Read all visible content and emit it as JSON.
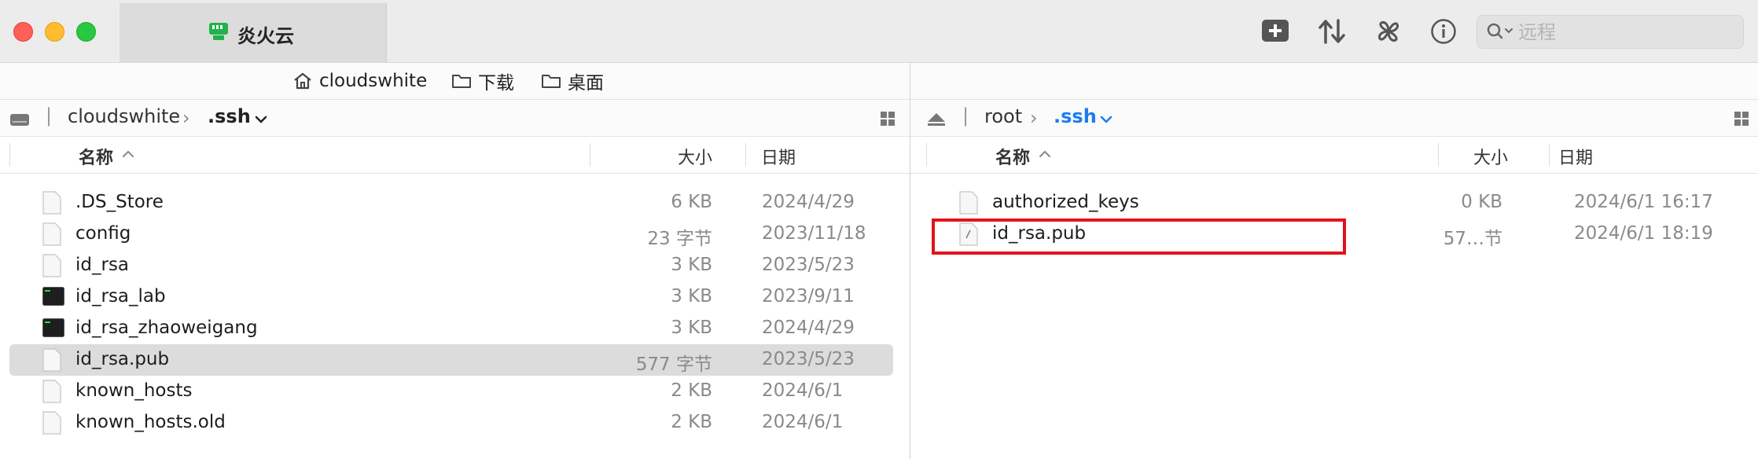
{
  "window": {
    "tab_title": "炎火云"
  },
  "toolbar": {
    "icons": [
      "new-plus-icon",
      "transfer-arrows-icon",
      "fan-icon",
      "info-icon"
    ],
    "search_placeholder": "远程"
  },
  "left": {
    "favorites": [
      {
        "icon": "home-icon",
        "label": "cloudswhite"
      },
      {
        "icon": "folder-icon",
        "label": "下载"
      },
      {
        "icon": "folder-icon",
        "label": "桌面"
      }
    ],
    "path": {
      "root": "cloudswhite",
      "current": ".ssh"
    },
    "columns": {
      "name": "名称",
      "size": "大小",
      "date": "日期"
    },
    "files": [
      {
        "name": ".DS_Store",
        "size": "6 KB",
        "date": "2024/4/29",
        "icon": "document-icon"
      },
      {
        "name": "config",
        "size": "23 字节",
        "date": "2023/11/18",
        "icon": "document-icon"
      },
      {
        "name": "id_rsa",
        "size": "3 KB",
        "date": "2023/5/23",
        "icon": "document-icon"
      },
      {
        "name": "id_rsa_lab",
        "size": "3 KB",
        "date": "2023/9/11",
        "icon": "terminal-file-icon"
      },
      {
        "name": "id_rsa_zhaoweigang",
        "size": "3 KB",
        "date": "2024/4/29",
        "icon": "terminal-file-icon"
      },
      {
        "name": "id_rsa.pub",
        "size": "577 字节",
        "date": "2023/5/23",
        "icon": "document-icon",
        "selected": true
      },
      {
        "name": "known_hosts",
        "size": "2 KB",
        "date": "2024/6/1",
        "icon": "document-icon"
      },
      {
        "name": "known_hosts.old",
        "size": "2 KB",
        "date": "2024/6/1",
        "icon": "document-icon"
      }
    ]
  },
  "right": {
    "path": {
      "root": "root",
      "current": ".ssh"
    },
    "columns": {
      "name": "名称",
      "size": "大小",
      "date": "日期"
    },
    "files": [
      {
        "name": "authorized_keys",
        "size": "0 KB",
        "date": "2024/6/1 16:17",
        "icon": "document-icon"
      },
      {
        "name": "id_rsa.pub",
        "size": "57…节",
        "date": "2024/6/1 18:19",
        "icon": "text-document-icon"
      }
    ]
  },
  "colors": {
    "accent": "#1a7cf2",
    "highlight": "#e3131b",
    "selection": "#dcdcdc"
  }
}
